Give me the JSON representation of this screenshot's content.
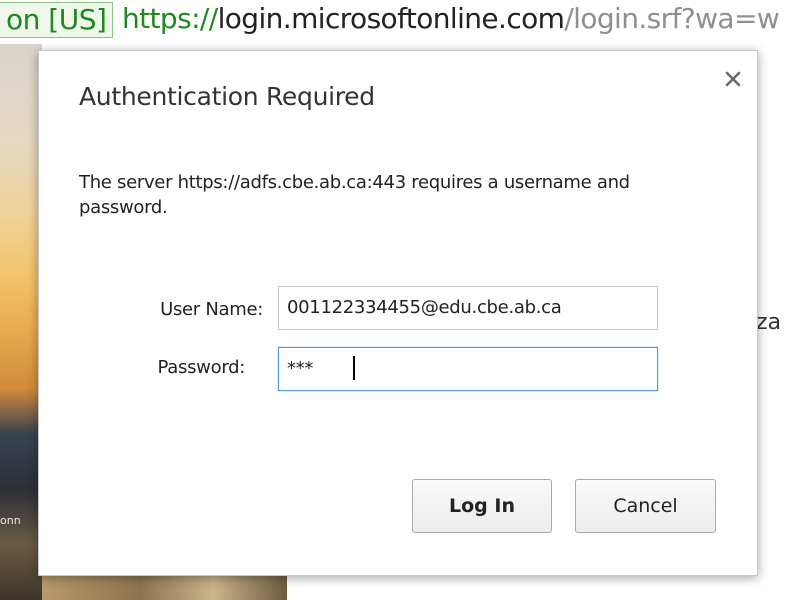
{
  "browser": {
    "ev_badge": "on [US]",
    "url_scheme": "https://",
    "url_host": "login.microsoftonline.com",
    "url_path": "/login.srf?wa=w",
    "accent_green": "#1e8a1e"
  },
  "background": {
    "left_fragment": "onn",
    "right_fragment": "niza"
  },
  "dialog": {
    "title": "Authentication Required",
    "close_icon": "close-icon",
    "message": "The server https://adfs.cbe.ab.ca:443 requires a username and password.",
    "fields": {
      "username_label": "User Name:",
      "username_value": "001122334455@edu.cbe.ab.ca",
      "password_label": "Password:",
      "password_value": "***"
    },
    "buttons": {
      "login": "Log In",
      "cancel": "Cancel"
    },
    "focus_color": "#5b9bd5"
  }
}
